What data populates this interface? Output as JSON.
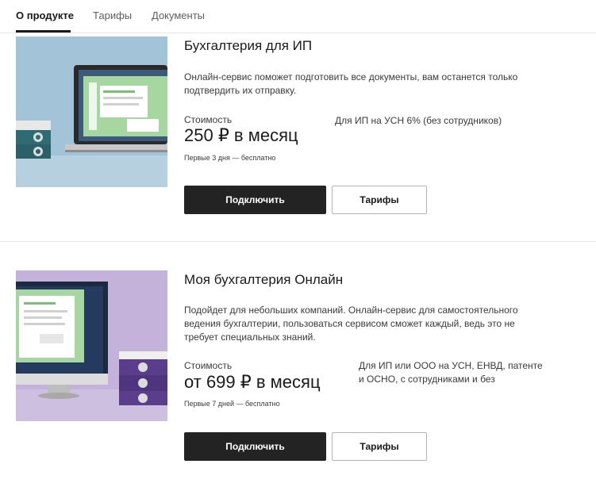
{
  "tabs": [
    {
      "label": "О продукте",
      "active": true
    },
    {
      "label": "Тарифы",
      "active": false
    },
    {
      "label": "Документы",
      "active": false
    }
  ],
  "products": [
    {
      "title": "Бухгалтерия для ИП",
      "description": "Онлайн-сервис поможет подготовить все документы, вам останется только подтвердить их отправку.",
      "cost_label": "Стоимость",
      "price": "250 ₽ в месяц",
      "trial": "Первые 3 дня — бесплатно",
      "for_whom": "Для ИП на УСН 6% (без сотрудников)",
      "connect_label": "Подключить",
      "tariffs_label": "Тарифы",
      "image": "laptop-on-blue-background"
    },
    {
      "title": "Моя бухгалтерия Онлайн",
      "description": "Подойдет для небольших компаний. Онлайн-сервис для самостоятельного ведения бухгалтерии, пользоваться сервисом сможет каждый, ведь это не требует специальных знаний.",
      "cost_label": "Стоимость",
      "price": "от 699 ₽ в месяц",
      "trial": "Первые 7 дней — бесплатно",
      "for_whom": "Для ИП или ООО на УСН, ЕНВД, патенте и ОСНО, с сотрудниками и без",
      "connect_label": "Подключить",
      "tariffs_label": "Тарифы",
      "image": "desktop-on-purple-background"
    }
  ],
  "colors": {
    "primary_button": "#232323",
    "thumb1_bg": "#9fc0d6",
    "thumb2_bg": "#c2b0d8",
    "screen_green": "#a7d7a1"
  }
}
